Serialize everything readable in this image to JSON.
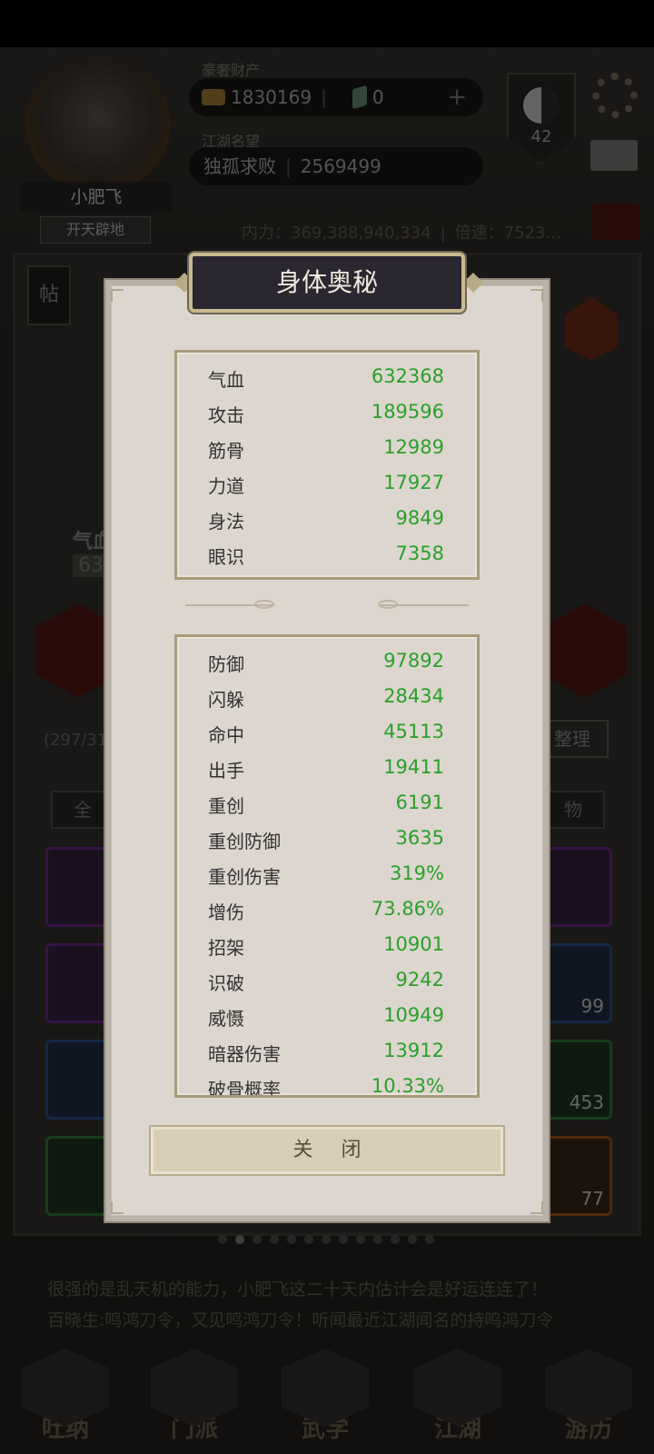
{
  "header": {
    "player_name": "小肥飞",
    "player_title": "开天辟地",
    "currency_label": "豪奢财产",
    "gold_amount": "1830169",
    "gem_amount": "0",
    "fame_label": "江湖名望",
    "fame_title": "独孤求败",
    "fame_value": "2569499",
    "taiji_level": "42",
    "power_label": "内力：",
    "power_value": "369,388,940,334",
    "multiplier_label": "倍速：",
    "multiplier_value": "7523..."
  },
  "background": {
    "close_top_label": "关 闭",
    "tag_label": "帖",
    "left_stat_label": "气血",
    "left_stat_value": "632",
    "bag_count": "(297/31",
    "sort_label": "整理",
    "filter_left": "全",
    "filter_right": "物",
    "slot_counts": [
      "99",
      "453",
      "77"
    ],
    "news_line_1": "很强的是乱天机的能力，小肥飞这二十天内估计会是好运连连了！",
    "news_line_2": "百晓生:鸣鸿刀令，又见鸣鸿刀令！听闻最近江湖闻名的持鸣鸿刀令",
    "nav": [
      "吐纳",
      "门派",
      "武学",
      "江湖",
      "游历"
    ]
  },
  "modal": {
    "title": "身体奥秘",
    "close_label": "关 闭",
    "basic_stats": [
      {
        "label": "气血",
        "value": "632368"
      },
      {
        "label": "攻击",
        "value": "189596"
      },
      {
        "label": "筋骨",
        "value": "12989"
      },
      {
        "label": "力道",
        "value": "17927"
      },
      {
        "label": "身法",
        "value": "9849"
      },
      {
        "label": "眼识",
        "value": "7358"
      }
    ],
    "advanced_stats": [
      {
        "label": "防御",
        "value": "97892"
      },
      {
        "label": "闪躲",
        "value": "28434"
      },
      {
        "label": "命中",
        "value": "45113"
      },
      {
        "label": "出手",
        "value": "19411"
      },
      {
        "label": "重创",
        "value": "6191"
      },
      {
        "label": "重创防御",
        "value": "3635"
      },
      {
        "label": "重创伤害",
        "value": "319%"
      },
      {
        "label": "增伤",
        "value": "73.86%"
      },
      {
        "label": "招架",
        "value": "10901"
      },
      {
        "label": "识破",
        "value": "9242"
      },
      {
        "label": "威慑",
        "value": "10949"
      },
      {
        "label": "暗器伤害",
        "value": "13912"
      },
      {
        "label": "破骨概率",
        "value": "10.33%"
      }
    ]
  }
}
